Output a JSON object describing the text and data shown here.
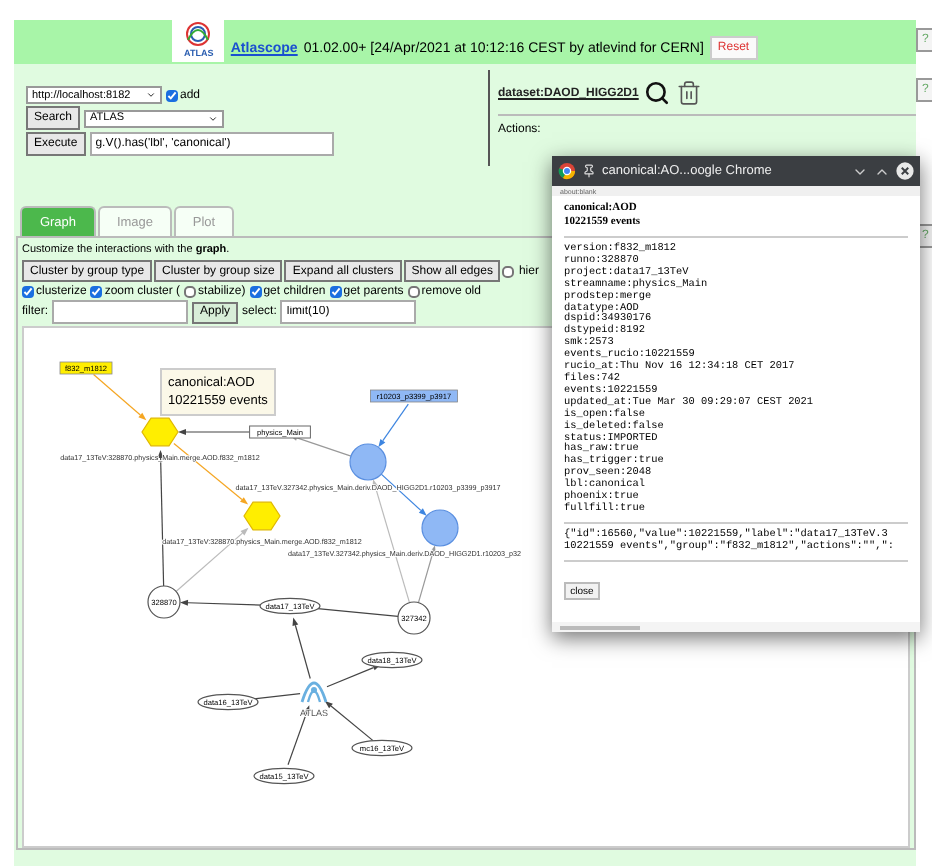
{
  "header": {
    "logo_text": "ATLAS",
    "app_link": "Atlascope",
    "info": "01.02.00+ [24/Apr/2021 at 10:12:16 CEST by atlevind for CERN]",
    "reset_button": "Reset"
  },
  "help_buttons": [
    "?",
    "?",
    "?"
  ],
  "query": {
    "server": "http://localhost:8182",
    "add": {
      "label": "add",
      "checked": true
    },
    "search_button": "Search",
    "scope": "ATLAS",
    "execute_button": "Execute",
    "query": "g.V().has('lbl', 'canonical')"
  },
  "selection": {
    "dataset_link": "dataset:DAOD_HIGG2D1",
    "actions_label": "Actions:"
  },
  "tabs": [
    {
      "label": "Graph",
      "selected": true
    },
    {
      "label": "Image",
      "selected": false
    },
    {
      "label": "Plot",
      "selected": false
    }
  ],
  "graph_panel": {
    "intro": "Customize the interactions with the **graph**.",
    "buttons": [
      "Cluster by group type",
      "Cluster by group size",
      "Expand all clusters",
      "Show all edges"
    ],
    "row_option": {
      "label": "hier",
      "checked": false
    },
    "options": [
      {
        "label": "clusterize",
        "checked": true
      },
      {
        "label": "zoom cluster (",
        "checked": true
      },
      {
        "label": "stabilize)",
        "checked": false
      },
      {
        "label": "get children",
        "checked": true
      },
      {
        "label": "get parents",
        "checked": true
      },
      {
        "label": "remove old",
        "checked": false
      }
    ],
    "filter_label": "filter:",
    "apply_button": "Apply",
    "select_label": "select:",
    "select_value": "limit(10)"
  },
  "graph": {
    "nodes": [
      {
        "kind": "tag",
        "label": "f832_m1812",
        "color": "#ffee00"
      },
      {
        "kind": "tag",
        "label": "r10203_p3399_p3917",
        "color": "#8fb8f5"
      },
      {
        "kind": "label",
        "label": "physics_Main"
      },
      {
        "kind": "hexagon",
        "caption": "data17_13TeV:328870.physics_Main.merge.AOD.f832_m1812",
        "color": "#ffee00"
      },
      {
        "kind": "hexagon",
        "caption": "data17_13TeV:328870.physics_Main.merge.AOD.f832_m1812",
        "color": "#ffee00"
      },
      {
        "kind": "dot",
        "caption": "data17_13TeV.327342.physics_Main.deriv.DAOD_HIGG2D1.r10203_p3399_p3917",
        "color": "#8fb8f5"
      },
      {
        "kind": "dot",
        "caption": "data17_13TeV.327342.physics_Main.deriv.DAOD_HIGG2D1.r10203_p32",
        "color": "#8fb8f5"
      },
      {
        "kind": "run",
        "label": "328870"
      },
      {
        "kind": "run",
        "label": "327342"
      },
      {
        "kind": "ellipse",
        "label": "data17_13TeV"
      },
      {
        "kind": "ellipse",
        "label": "data18_13TeV"
      },
      {
        "kind": "ellipse",
        "label": "data16_13TeV"
      },
      {
        "kind": "ellipse",
        "label": "mc16_13TeV"
      },
      {
        "kind": "ellipse",
        "label": "data15_13TeV"
      },
      {
        "kind": "experiment",
        "caption": "ATLAS"
      }
    ],
    "tooltip": [
      "canonical:AOD",
      "10221559 events"
    ]
  },
  "popup": {
    "title": "canonical:AO...oogle Chrome",
    "address": "about:blank",
    "heading": [
      "canonical:AOD",
      "10221559 events"
    ],
    "properties": [
      "version:f832_m1812",
      "runno:328870",
      "project:data17_13TeV",
      "streamname:physics_Main",
      "prodstep:merge",
      "datatype:AOD",
      "dspid:34930176",
      "dstypeid:8192",
      "smk:2573",
      "events_rucio:10221559",
      "rucio_at:Thu Nov 16 12:34:18 CET 2017",
      "files:742",
      "events:10221559",
      "updated_at:Tue Mar 30 09:29:07 CEST 2021",
      "is_open:false",
      "is_deleted:false",
      "status:IMPORTED",
      "has_raw:true",
      "has_trigger:true",
      "prov_seen:2048",
      "lbl:canonical",
      "phoenix:true",
      "fullfill:true"
    ],
    "json": [
      "{\"id\":16560,\"value\":10221559,\"label\":\"data17_13TeV.3",
      "10221559 events\",\"group\":\"f832_m1812\",\"actions\":\"\",\":"
    ],
    "close_button": "close"
  }
}
